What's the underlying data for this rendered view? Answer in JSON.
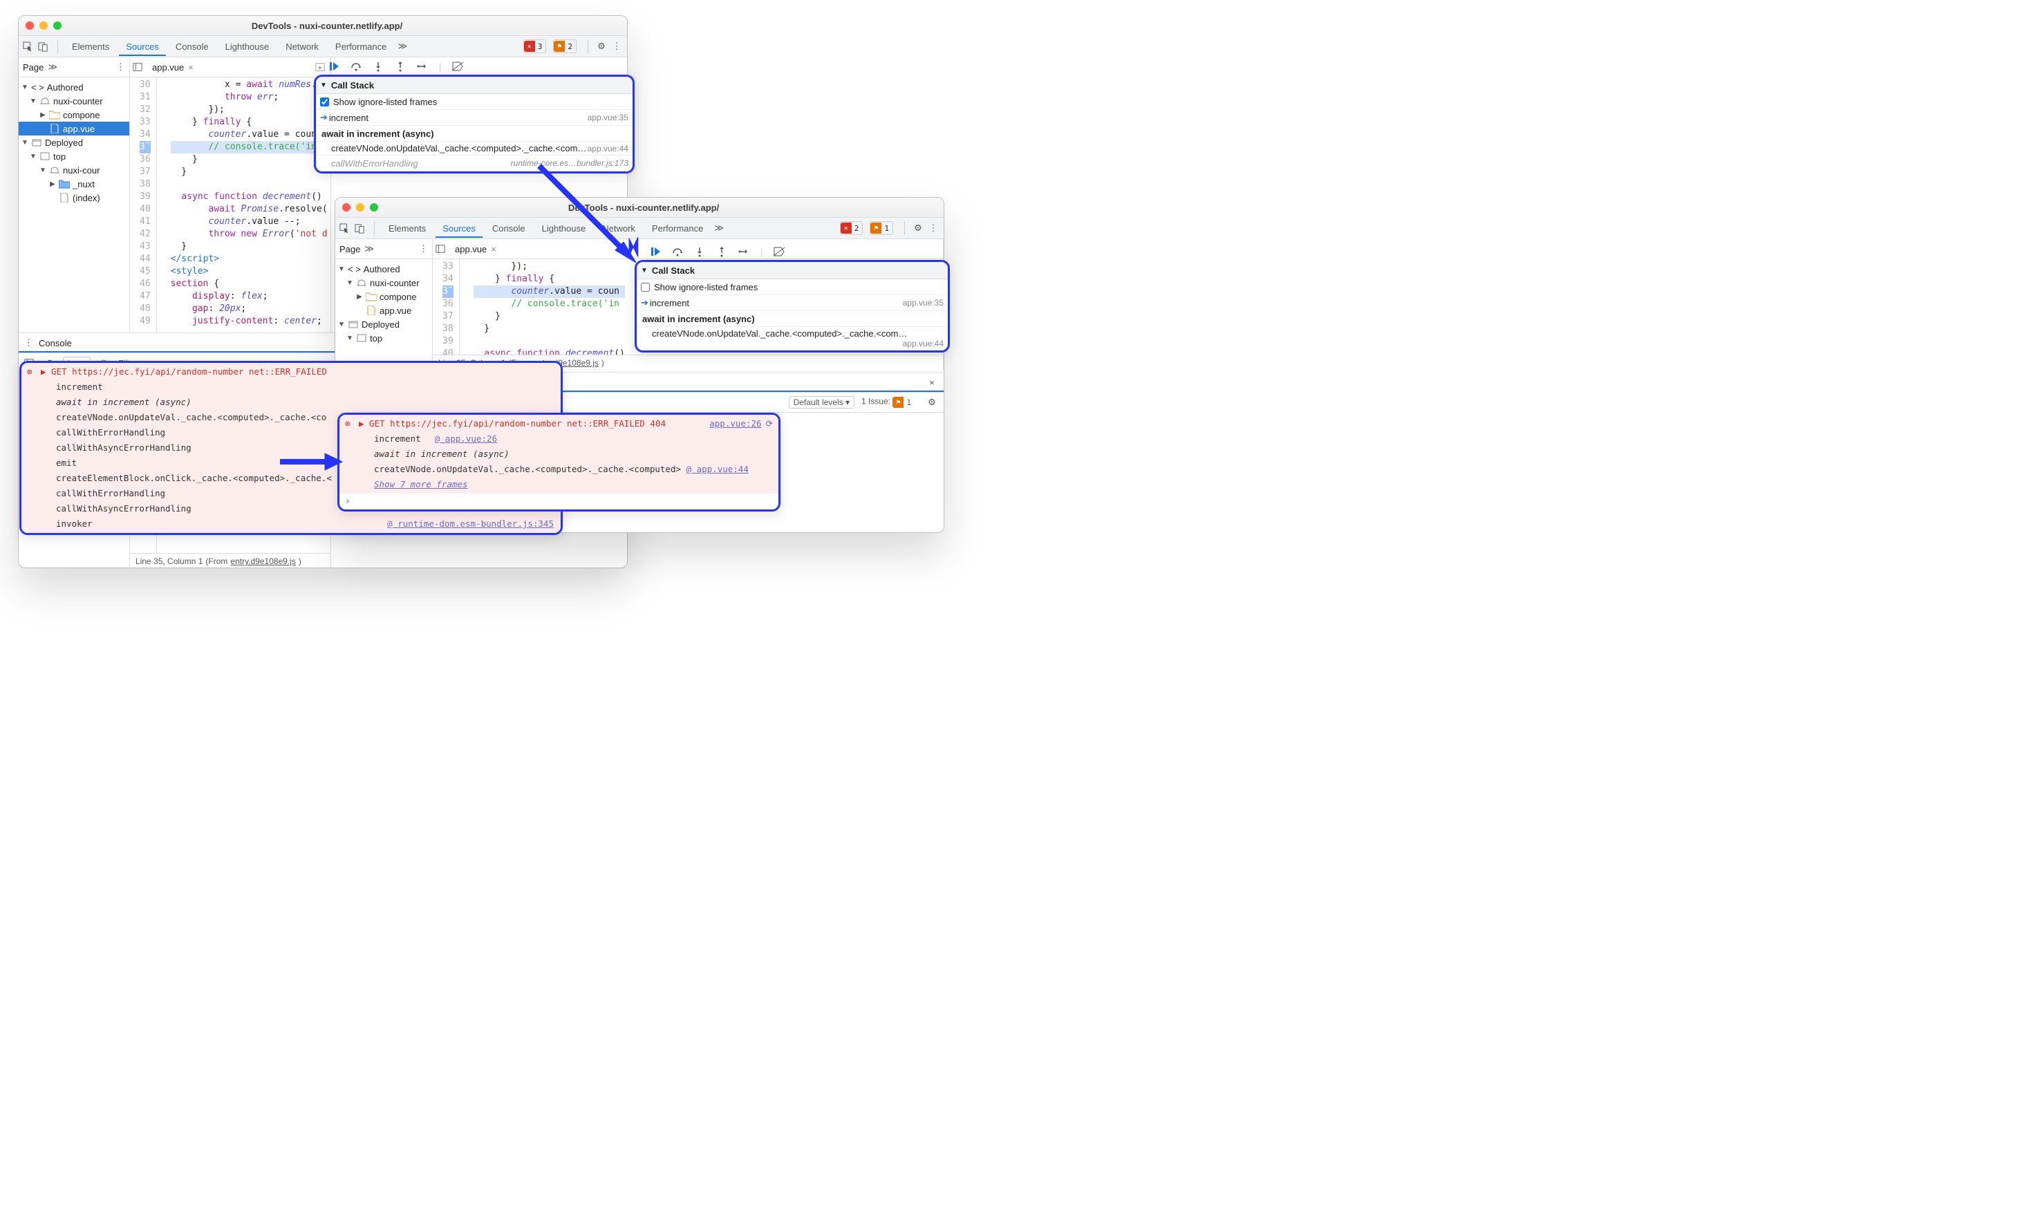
{
  "shared": {
    "window_title": "DevTools - nuxi-counter.netlify.app/",
    "panels": [
      "Elements",
      "Sources",
      "Console",
      "Lighthouse",
      "Network",
      "Performance"
    ],
    "active_panel": "Sources",
    "page_label": "Page",
    "filter_placeholder": "Filter",
    "execution_ctx": "top",
    "active_file": "app.vue",
    "status_line": "Line 35, Column 1",
    "status_from": "(From ",
    "status_link": "entry.d9e108e9.js",
    "console_label": "Console"
  },
  "tree": {
    "authored": "Authored",
    "deployed": "Deployed",
    "items1": [
      "nuxi-counter",
      "compone",
      "app.vue",
      "top",
      "nuxi-cour",
      "_nuxt",
      "(index)"
    ],
    "items2": [
      "nuxi-counter",
      "compone",
      "app.vue",
      "top"
    ]
  },
  "code1": {
    "start": 30,
    "current": 35,
    "lines": [
      "          x = await numRes.tex",
      "          throw err;",
      "       });",
      "    } finally {",
      "       counter.value = coun",
      "       // console.trace('in",
      "    }",
      "  }",
      "",
      "  async function decrement()",
      "       await Promise.resolve(",
      "       counter.value --;",
      "       throw new Error('not d",
      "  }",
      "</script>",
      "<style>",
      "section {",
      "    display: flex;",
      "    gap: 20px;",
      "    justify-content: center;"
    ]
  },
  "code2": {
    "start": 33,
    "current": 35,
    "lines": [
      "       });",
      "    } finally {",
      "       counter.value = coun",
      "       // console.trace('in",
      "    }",
      "  }",
      "",
      "  async function decrement()"
    ]
  },
  "callstack": {
    "title": "Call Stack",
    "checkbox_label": "Show ignore-listed frames",
    "increment": "increment",
    "increment_loc": "app.vue:35",
    "async": "await in increment (async)",
    "vnode": "createVNode.onUpdateVal._cache.<computed>._cache.<com…",
    "vnode_loc": "app.vue:44",
    "ignored": "callWithErrorHandling",
    "ignored_loc": "runtime-core.es…bundler.js:173"
  },
  "w1": {
    "err_count": "3",
    "warn_count": "2",
    "console_err_head": "▶ GET https://jec.fyi/api/random-number net::ERR_FAILED",
    "stack": [
      "increment",
      "await in increment (async)",
      "createVNode.onUpdateVal._cache.<computed>._cache.<co",
      "callWithErrorHandling",
      "callWithAsyncErrorHandling",
      "emit",
      "createElementBlock.onClick._cache.<computed>._cache.<",
      "callWithErrorHandling",
      "callWithAsyncErrorHandling",
      "invoker"
    ],
    "stack_src": "@ runtime-dom.esm-bundler.js:345"
  },
  "w2": {
    "err_count": "2",
    "warn_count": "1",
    "default_levels": "Default levels",
    "issues_label": "1 Issue:",
    "console_err_head": "▶ GET https://jec.fyi/api/random-number net::ERR_FAILED 404",
    "console_src": "app.vue:26",
    "stack1": "increment",
    "stack1_src": "@ app.vue:26",
    "stack2": "await in increment (async)",
    "stack3": "createVNode.onUpdateVal._cache.<computed>._cache.<computed>",
    "stack3_src": "@ app.vue:44",
    "show_more": "Show 7 more frames"
  }
}
